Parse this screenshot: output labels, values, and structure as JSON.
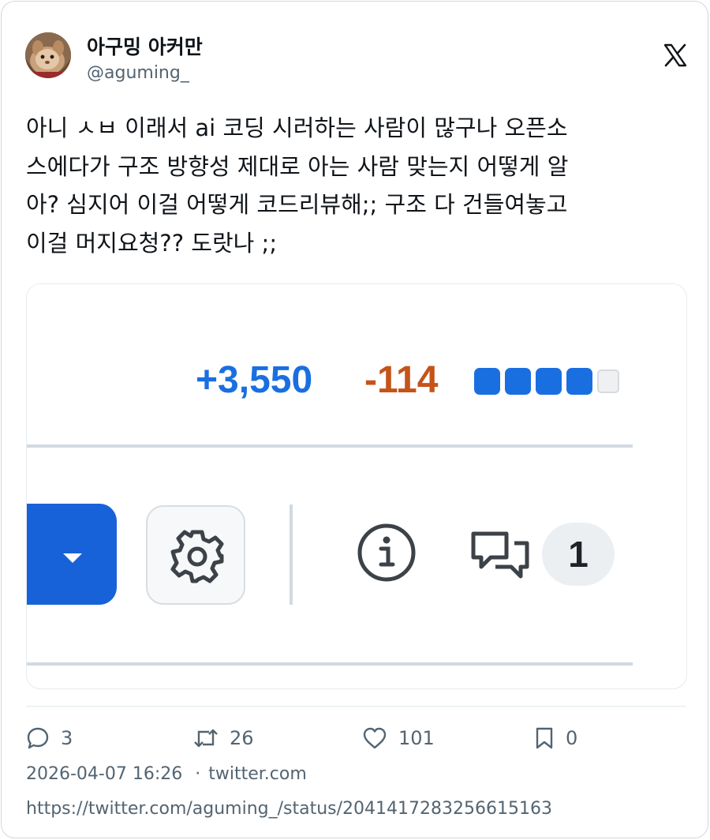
{
  "author": {
    "display_name": "아구밍 아커만",
    "handle": "@aguming_"
  },
  "platform_logo": "x-logo",
  "tweet": {
    "lines": [
      "아니 ㅅㅂ 이래서 ai 코딩 시러하는 사람이 많구나 오픈소",
      "스에다가 구조 방향성 제대로 아는 사람 맞는지 어떻게 알",
      "아? 심지어 이걸 어떻게 코드리뷰해;; 구조 다 건들여놓고",
      "이걸 머지요청?? 도랏나 ;;"
    ]
  },
  "media": {
    "additions": "+3,550",
    "deletions": "-114",
    "diffstat_blocks": [
      "added",
      "added",
      "added",
      "added",
      "neutral"
    ],
    "comment_count": "1",
    "icons": [
      "chevron-down-icon",
      "gear-icon",
      "info-icon",
      "comments-icon"
    ],
    "colors": {
      "added": "#1a6fe0",
      "deleted": "#c4541a",
      "neutral": "#eef0f2",
      "button": "#1762d8"
    }
  },
  "actions": {
    "replies": "3",
    "retweets": "26",
    "likes": "101",
    "bookmarks": "0"
  },
  "meta": {
    "timestamp": "2026-04-07 16:26",
    "separator": "·",
    "source": "twitter.com",
    "url": "https://twitter.com/aguming_/status/2041417283256615163"
  }
}
